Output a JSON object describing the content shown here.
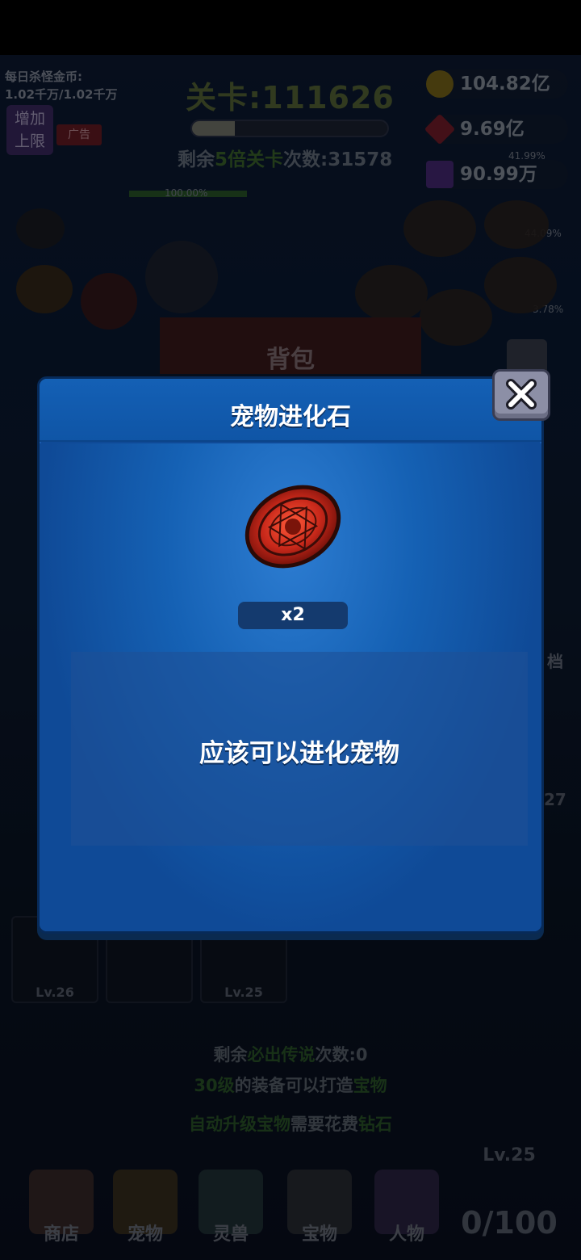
{
  "hud": {
    "daily_label": "每日杀怪金币:",
    "daily_value": "1.02千万/1.02千万",
    "ad_button_label": "增加\n上限",
    "ad_tag": "广告",
    "level_title": "关卡:111626",
    "remain_prefix": "剩余",
    "remain_highlight": "5倍关卡",
    "remain_suffix": "次数:31578",
    "currency_gold": "104.82亿",
    "currency_gem": "9.69亿",
    "currency_crystal": "90.99万",
    "pct_1": "41.99%",
    "pct_2": "44.09%",
    "pct_3": "3.78%",
    "hero_hp": "100.00%"
  },
  "background_panel": {
    "title": "背包",
    "side_tab": "档",
    "slot_levels": [
      "Lv.26",
      "Lv.25"
    ],
    "slot_number": "27"
  },
  "info": {
    "line1_prefix": "剩余",
    "line1_highlight": "必出传说",
    "line1_suffix": "次数:0",
    "line2_highlight": "30级",
    "line2_middle": "的装备可以打造",
    "line2_highlight2": "宝物",
    "line3_highlight": "自动升级宝物",
    "line3_middle": "需要花费",
    "line3_highlight2": "钻石"
  },
  "nav": {
    "items": [
      {
        "label": "商店",
        "icon": "shop-icon"
      },
      {
        "label": "宠物",
        "icon": "pet-icon"
      },
      {
        "label": "灵兽",
        "icon": "spirit-beast-icon"
      },
      {
        "label": "宝物",
        "icon": "treasure-icon"
      },
      {
        "label": "人物",
        "icon": "character-icon"
      }
    ],
    "chest_level": "Lv.25",
    "chest_count": "0/100"
  },
  "modal": {
    "title": "宠物进化石",
    "item_icon": "pet-evolution-stone-icon",
    "quantity": "x2",
    "description": "应该可以进化宠物",
    "close_icon": "close-icon"
  },
  "colors": {
    "modal_bg": "#0f4a97",
    "modal_border": "#072a58",
    "close_button": "#8c8fa6",
    "stone_red": "#c8281a"
  }
}
